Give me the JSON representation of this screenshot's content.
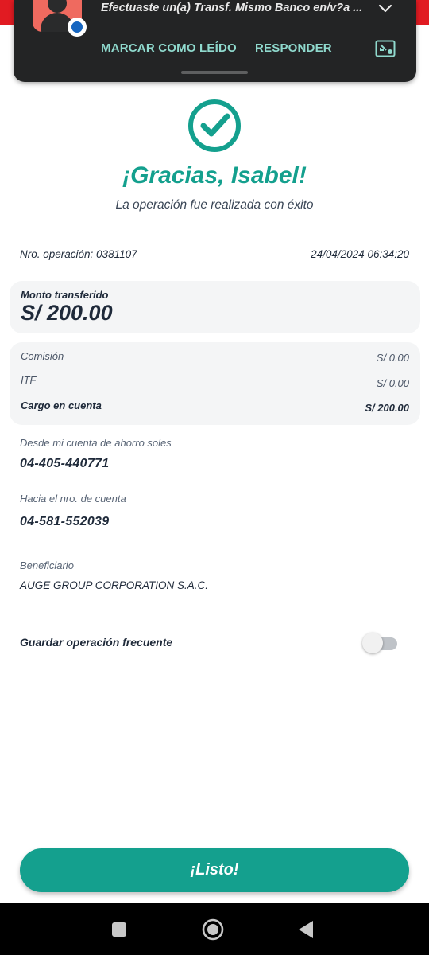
{
  "notification": {
    "title": "Efectuaste un(a) Transf. Mismo Banco en/v?a ...",
    "actions": [
      "MARCAR COMO LEÍDO",
      "RESPONDER"
    ],
    "icons": [
      "avatar-icon",
      "messages-badge-icon",
      "chevron-down-icon",
      "picture-in-picture-icon"
    ]
  },
  "header": {
    "check_icon": "check-circle-icon",
    "thanks": "¡Gracias, Isabel!",
    "subtitle": "La operación fue realizada con éxito"
  },
  "operation": {
    "number": "Nro. operación: 0381107",
    "datetime": "24/04/2024 06:34:20"
  },
  "amount": {
    "label": "Monto transferido",
    "value": "S/ 200.00"
  },
  "charges": [
    {
      "label": "Comisión",
      "value": "S/ 0.00"
    },
    {
      "label": "ITF",
      "value": "S/ 0.00"
    },
    {
      "label": "Cargo en cuenta",
      "value": "S/ 200.00"
    }
  ],
  "from": {
    "label": "Desde mi cuenta de ahorro soles",
    "value": "04-405-440771"
  },
  "to": {
    "label": "Hacia el nro. de cuenta",
    "value": "04-581-552039"
  },
  "beneficiary": {
    "label": "Beneficiario",
    "value": "AUGE GROUP CORPORATION S.A.C."
  },
  "save_frequent": {
    "label": "Guardar operación frecuente",
    "enabled": false
  },
  "done_button": "¡Listo!",
  "colors": {
    "brand": "#14a08e",
    "top_bar": "#e11b22",
    "notification_bg": "#232425",
    "notification_action": "#8fd9cd"
  }
}
